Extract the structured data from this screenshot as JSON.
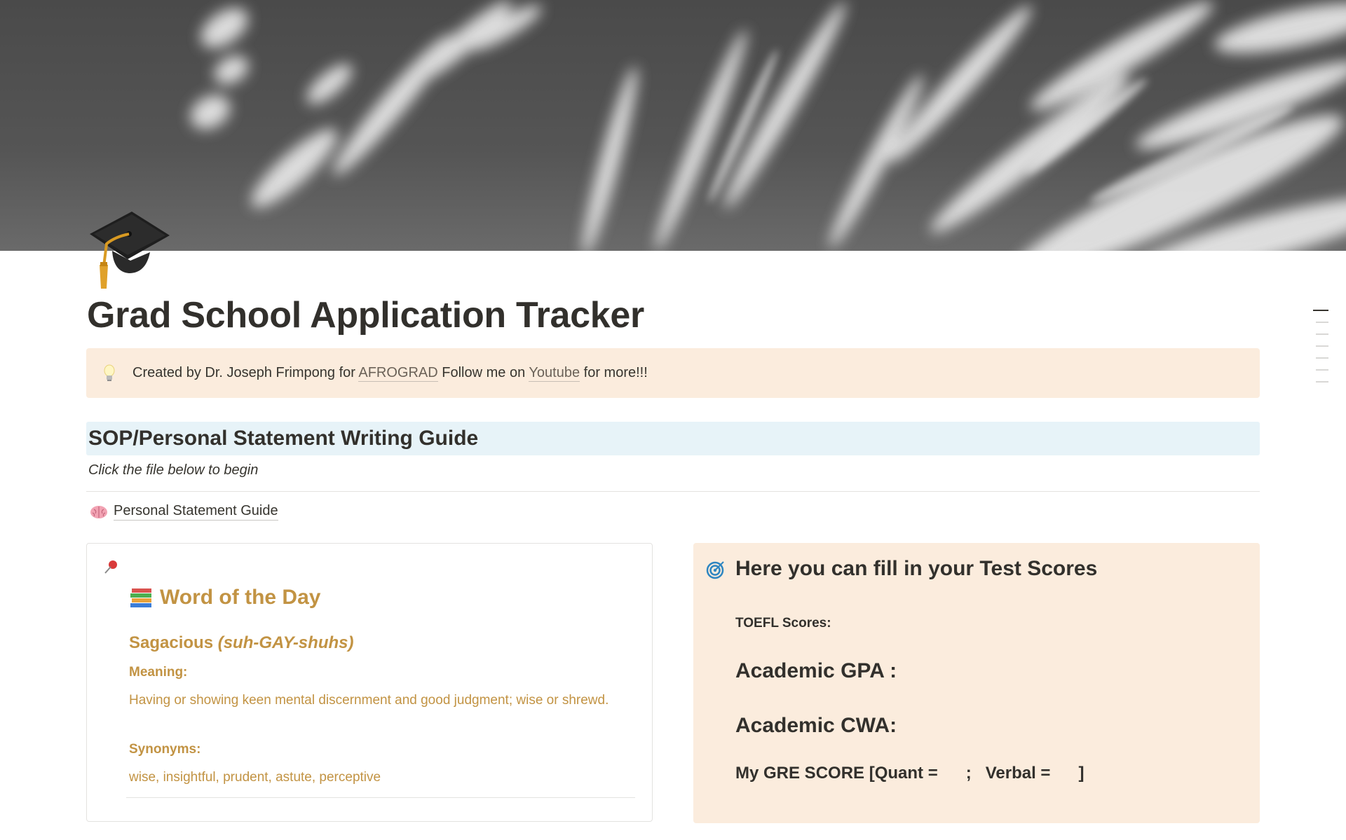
{
  "cover": {
    "description_icon": "shadow-leaves-cover-image"
  },
  "page": {
    "icon": "graduation-cap-icon",
    "title": "Grad School Application Tracker"
  },
  "callout": {
    "icon": "lightbulb-icon",
    "prefix": "Created by Dr. Joseph Frimpong for ",
    "link1": "AFROGRAD",
    "middle": " Follow me on ",
    "link2": "Youtube",
    "suffix": " for more!!!"
  },
  "sop_section": {
    "heading": "SOP/Personal Statement Writing Guide",
    "note": "Click the file below to begin",
    "link_icon": "brain-icon",
    "link_label": "Personal Statement Guide"
  },
  "word_of_day": {
    "pin_icon": "pushpin-icon",
    "title_icon": "books-icon",
    "title": "Word of the Day",
    "word": "Sagacious",
    "pronunciation": "(suh-GAY-shuhs)",
    "meaning_label": "Meaning:",
    "meaning": "Having or showing keen mental discernment and good judgment; wise or shrewd.",
    "synonyms_label": "Synonyms:",
    "synonyms": "wise, insightful, prudent, astute, perceptive"
  },
  "test_scores": {
    "icon": "target-icon",
    "heading": "Here you can fill in your Test Scores",
    "toefl": "TOEFL Scores:",
    "gpa": "Academic GPA :",
    "cwa": "Academic CWA:",
    "gre": "My GRE SCORE [Quant =      ;   Verbal =      ]"
  },
  "colors": {
    "callout_bg": "#fbecdd",
    "heading_blue_bg": "#e7f3f8",
    "gold_text": "#c29343"
  }
}
